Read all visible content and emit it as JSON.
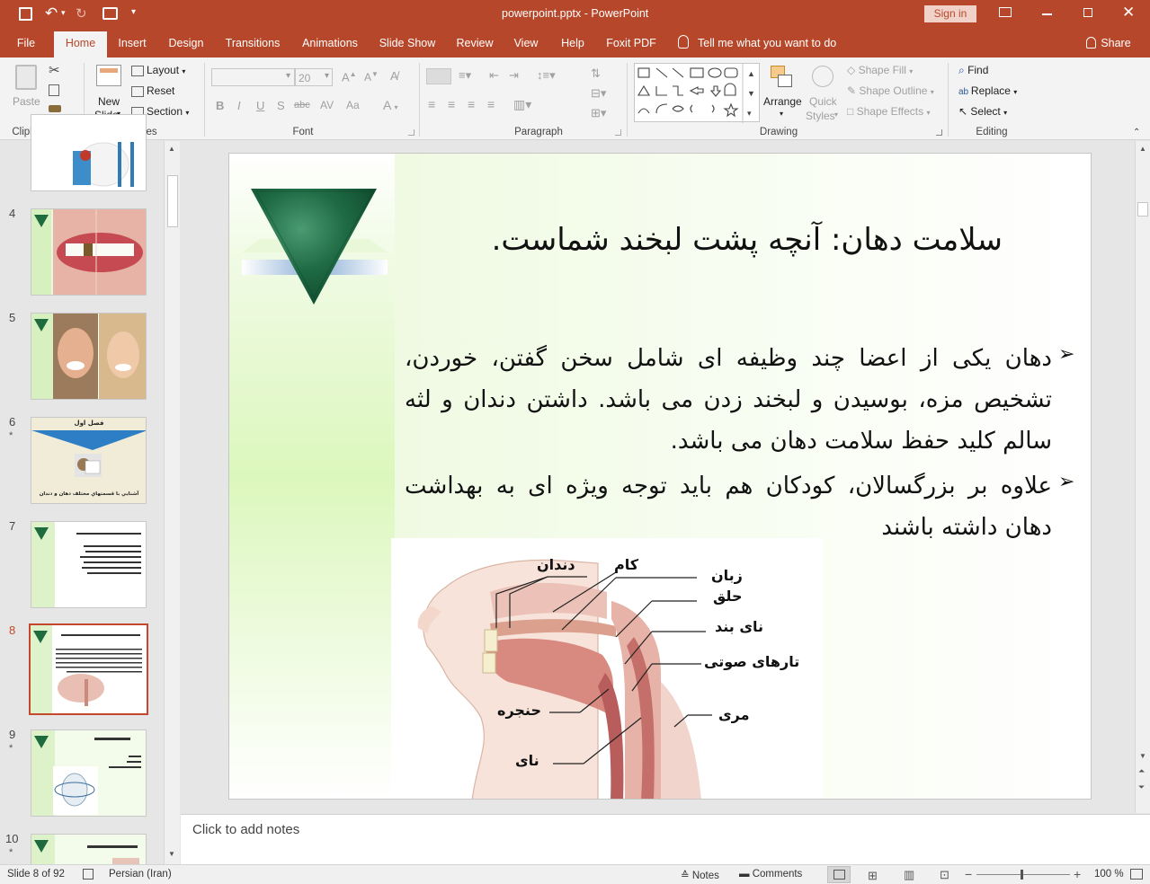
{
  "window": {
    "title": "powerpoint.pptx - PowerPoint",
    "sign_in": "Sign in"
  },
  "tabs": [
    "File",
    "Home",
    "Insert",
    "Design",
    "Transitions",
    "Animations",
    "Slide Show",
    "Review",
    "View",
    "Help",
    "Foxit PDF"
  ],
  "tell_me": "Tell me what you want to do",
  "share": "Share",
  "ribbon": {
    "clipboard": {
      "label": "Clipboard",
      "paste": "Paste"
    },
    "slides": {
      "label": "Slides",
      "new_slide_1": "New",
      "new_slide_2": "Slide",
      "layout": "Layout",
      "reset": "Reset",
      "section": "Section"
    },
    "font": {
      "label": "Font",
      "size": "20"
    },
    "paragraph": {
      "label": "Paragraph"
    },
    "drawing": {
      "label": "Drawing",
      "arrange": "Arrange",
      "quick_styles_1": "Quick",
      "quick_styles_2": "Styles",
      "shape_fill": "Shape Fill",
      "shape_outline": "Shape Outline",
      "shape_effects": "Shape Effects"
    },
    "editing": {
      "label": "Editing",
      "find": "Find",
      "replace": "Replace",
      "select": "Select"
    }
  },
  "thumbnails": [
    {
      "num": "4",
      "star": ""
    },
    {
      "num": "5",
      "star": ""
    },
    {
      "num": "6",
      "star": "*",
      "title": "فصل اول",
      "caption": "آشنايي با قسمتهاي مختلف دهان و دندان"
    },
    {
      "num": "7",
      "star": ""
    },
    {
      "num": "8",
      "star": "",
      "selected": true
    },
    {
      "num": "9",
      "star": "*"
    },
    {
      "num": "10",
      "star": "*"
    }
  ],
  "slide": {
    "title": "سلامت دهان: آنچه پشت لبخند شماست.",
    "bullet1": "دهان یکی از اعضا چند وظیفه ای شامل سخن گفتن، خوردن، تشخیص مزه، بوسیدن و لبخند زدن می باشد. داشتن دندان و لثه سالم کلید حفظ سلامت دهان می باشد.",
    "bullet2": "علاوه بر بزرگسالان، کودکان هم باید توجه ویژه ای به بهداشت دهان داشته باشند",
    "diagram_labels": {
      "teeth": "دندان",
      "palate": "کام",
      "tongue": "زبان",
      "pharynx": "حلق",
      "epiglottis": "نای بند",
      "vocal_cords": "تارهای صوتی",
      "larynx": "حنجره",
      "esophagus": "مری",
      "trachea": "نای"
    }
  },
  "notes_placeholder": "Click to add notes",
  "status": {
    "slide_info": "Slide 8 of 92",
    "language": "Persian (Iran)",
    "notes": "Notes",
    "comments": "Comments",
    "zoom": "100 %"
  },
  "colors": {
    "accent": "#b7472a",
    "selected_border": "#c4492c"
  }
}
